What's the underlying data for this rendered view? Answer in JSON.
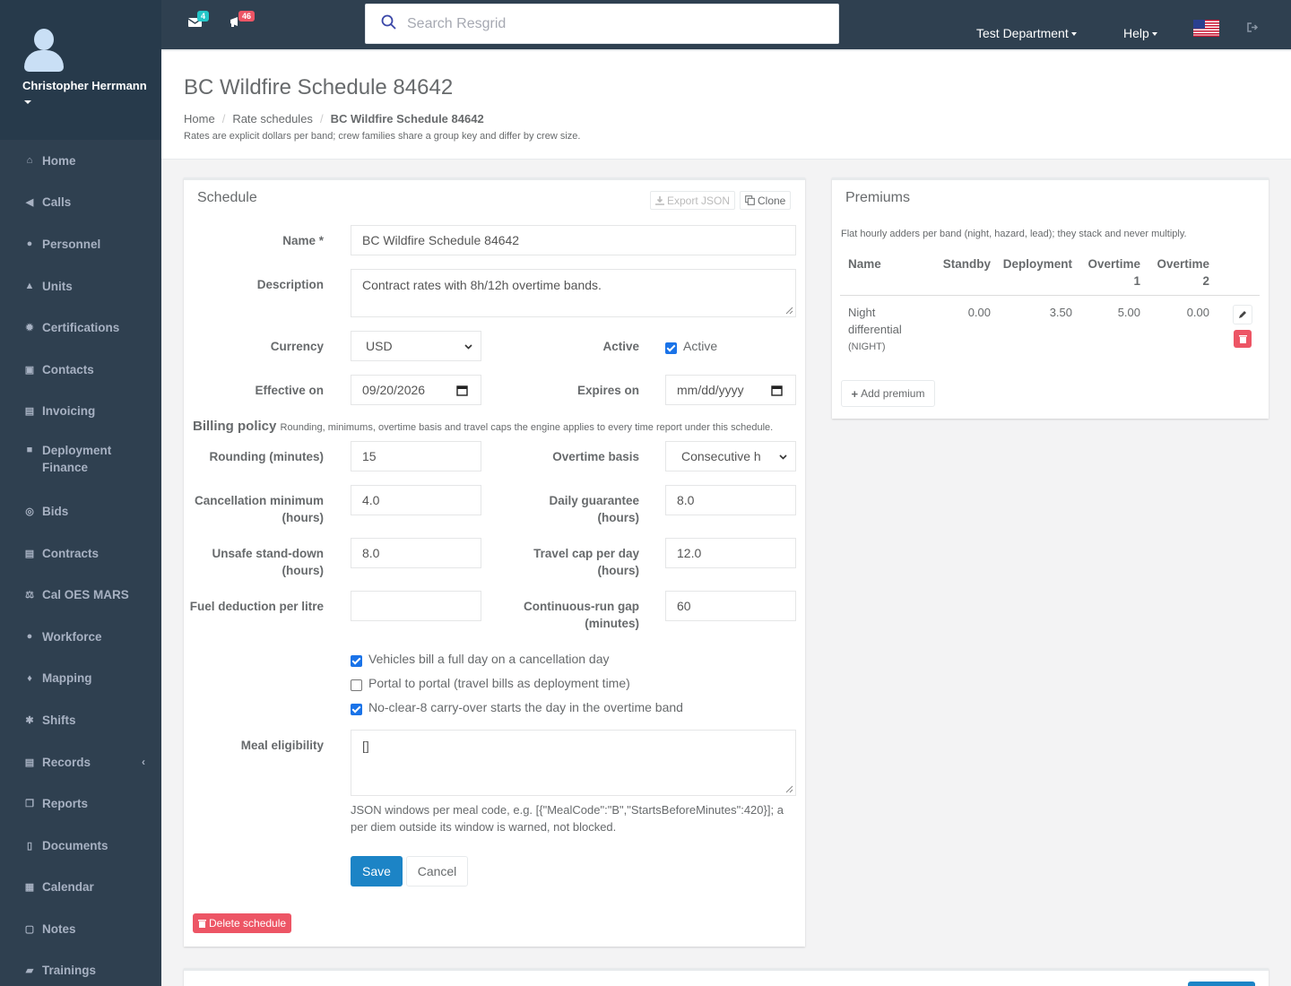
{
  "user": {
    "name": "Christopher Herrmann"
  },
  "sidebar": {
    "items": [
      {
        "label": "Home",
        "icon": "home-icon",
        "glyph": "⌂"
      },
      {
        "label": "Calls",
        "icon": "megaphone-icon",
        "glyph": "◀"
      },
      {
        "label": "Personnel",
        "icon": "user-icon",
        "glyph": "●"
      },
      {
        "label": "Units",
        "icon": "road-icon",
        "glyph": "▲"
      },
      {
        "label": "Certifications",
        "icon": "certificate-icon",
        "glyph": "✹"
      },
      {
        "label": "Contacts",
        "icon": "contact-card-icon",
        "glyph": "▣"
      },
      {
        "label": "Invoicing",
        "icon": "file-icon",
        "glyph": "▤"
      },
      {
        "label": "Deployment Finance",
        "icon": "truck-icon",
        "glyph": "■"
      },
      {
        "label": "Bids",
        "icon": "handshake-icon",
        "glyph": "◎"
      },
      {
        "label": "Contracts",
        "icon": "file-text-icon",
        "glyph": "▤"
      },
      {
        "label": "Cal OES MARS",
        "icon": "balance-scale-icon",
        "glyph": "⚖"
      },
      {
        "label": "Workforce",
        "icon": "users-icon",
        "glyph": "●"
      },
      {
        "label": "Mapping",
        "icon": "map-marker-icon",
        "glyph": "♦"
      },
      {
        "label": "Shifts",
        "icon": "cogs-icon",
        "glyph": "✱"
      },
      {
        "label": "Records",
        "icon": "file-icon",
        "glyph": "▤"
      },
      {
        "label": "Reports",
        "icon": "copy-icon",
        "glyph": "❐"
      },
      {
        "label": "Documents",
        "icon": "file-o-icon",
        "glyph": "▯"
      },
      {
        "label": "Calendar",
        "icon": "calendar-icon",
        "glyph": "▦"
      },
      {
        "label": "Notes",
        "icon": "clipboard-icon",
        "glyph": "▢"
      },
      {
        "label": "Trainings",
        "icon": "book-icon",
        "glyph": "▰"
      }
    ]
  },
  "topbar": {
    "messages_count": "4",
    "alerts_count": "46",
    "search_placeholder": "Search Resgrid",
    "department": "Test Department",
    "help": "Help"
  },
  "page": {
    "title": "BC Wildfire Schedule 84642",
    "breadcrumb": [
      "Home",
      "Rate schedules",
      "BC Wildfire Schedule 84642"
    ],
    "note": "Rates are explicit dollars per band; crew families share a group key and differ by crew size."
  },
  "schedule": {
    "panel_title": "Schedule",
    "export_label": "Export JSON",
    "clone_label": "Clone",
    "name_label": "Name *",
    "name_value": "BC Wildfire Schedule 84642",
    "description_label": "Description",
    "description_value": "Contract rates with 8h/12h overtime bands.",
    "currency_label": "Currency",
    "currency_value": "USD",
    "active_label": "Active",
    "active_checkbox_label": "Active",
    "active_checked": true,
    "effective_label": "Effective on",
    "effective_value": "09/20/2026",
    "expires_label": "Expires on",
    "expires_placeholder": "mm/dd/yyyy",
    "billing_title": "Billing policy",
    "billing_note": "Rounding, minimums, overtime basis and travel caps the engine applies to every time report under this schedule.",
    "rounding_label": "Rounding (minutes)",
    "rounding_value": "15",
    "ot_basis_label": "Overtime basis",
    "ot_basis_value": "Consecutive h",
    "cancel_min_label": "Cancellation minimum (hours)",
    "cancel_min_value": "4.0",
    "daily_guarantee_label": "Daily guarantee (hours)",
    "daily_guarantee_value": "8.0",
    "unsafe_label": "Unsafe stand-down (hours)",
    "unsafe_value": "8.0",
    "travel_cap_label": "Travel cap per day (hours)",
    "travel_cap_value": "12.0",
    "fuel_label": "Fuel deduction per litre",
    "fuel_value": "",
    "continuous_label": "Continuous-run gap (minutes)",
    "continuous_value": "60",
    "checks": [
      {
        "label": "Vehicles bill a full day on a cancellation day",
        "checked": true
      },
      {
        "label": "Portal to portal (travel bills as deployment time)",
        "checked": false
      },
      {
        "label": "No-clear-8 carry-over starts the day in the overtime band",
        "checked": true
      }
    ],
    "meal_label": "Meal eligibility",
    "meal_value": "[]",
    "meal_help": "JSON windows per meal code, e.g. [{\"MealCode\":\"B\",\"StartsBeforeMinutes\":420}]; a per diem outside its window is warned, not blocked.",
    "save_label": "Save",
    "cancel_label": "Cancel",
    "delete_label": "Delete schedule"
  },
  "premiums": {
    "panel_title": "Premiums",
    "note": "Flat hourly adders per band (night, hazard, lead); they stack and never multiply.",
    "columns": [
      "Name",
      "Standby",
      "Deployment",
      "Overtime 1",
      "Overtime 2"
    ],
    "rows": [
      {
        "name": "Night differential",
        "code": "(NIGHT)",
        "standby": "0.00",
        "deployment": "3.50",
        "ot1": "5.00",
        "ot2": "0.00"
      }
    ],
    "add_label": "Add premium"
  },
  "colors": {
    "sidebar": "#2f4050",
    "primary": "#1c84c6",
    "danger": "#ed5565",
    "badge_info": "#23c6c8",
    "badge_danger": "#ed5565"
  }
}
